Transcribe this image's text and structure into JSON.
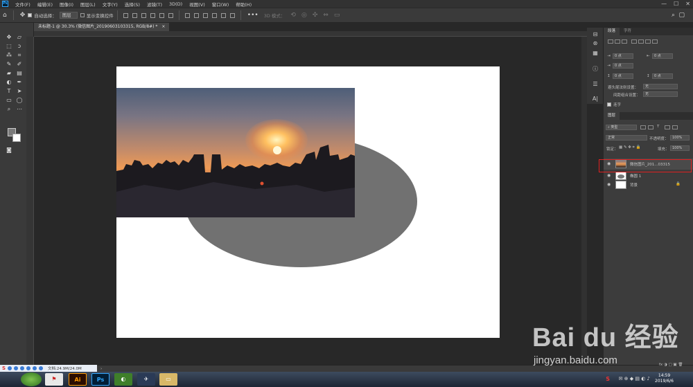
{
  "menubar": {
    "logo": "Ps",
    "items": [
      "文件(F)",
      "编辑(E)",
      "图像(I)",
      "图层(L)",
      "文字(Y)",
      "选择(S)",
      "滤镜(T)",
      "3D(D)",
      "视图(V)",
      "窗口(W)",
      "帮助(H)"
    ],
    "window_controls": [
      "—",
      "☐",
      "✕"
    ]
  },
  "options": {
    "auto_select_label": "自动选择：",
    "auto_select_value": "图层",
    "show_transform_label": "显示变换控件",
    "mode_label": "3D 模式：",
    "more": "•••"
  },
  "document": {
    "tab_title": "未标题-1 @ 30.3% (微信图片_20190603103315, RGB/8#) *",
    "tab_close": "×"
  },
  "status": {
    "zoom": "30.3%",
    "doc_size": "文档:24.9M/24.0M",
    "arrow": "›"
  },
  "panels": {
    "paragraph": {
      "tabs": [
        "段落",
        "字符"
      ],
      "indent_left": "0 点",
      "indent_right": "0 点",
      "first_line": "0 点",
      "space_before": "0 点",
      "space_after": "0 点",
      "hyphen_label": "避头尾法则设置：",
      "hyphen_value": "无",
      "spacing_label": "间距组合设置：",
      "spacing_value": "无",
      "hyphenate_label": "连字"
    },
    "layers": {
      "title": "图层",
      "filter_kind": "类型",
      "blend_mode": "正常",
      "opacity_label": "不透明度：",
      "opacity_value": "100%",
      "lock_label": "锁定：",
      "fill_label": "填充：",
      "fill_value": "100%",
      "items": [
        {
          "name": "微信图片_201...03315"
        },
        {
          "name": "椭圆 1"
        },
        {
          "name": "背景"
        }
      ]
    }
  },
  "taskbar": {
    "time": "14:59",
    "date": "2019/6/6",
    "apps": [
      "Ai",
      "Ps"
    ]
  },
  "watermark": {
    "brand": "Bai du 经验",
    "url": "jingyan.baidu.com"
  },
  "colors": {
    "accent": "#31a8ff",
    "highlight": "#e02020",
    "ellipse": "#717171"
  }
}
